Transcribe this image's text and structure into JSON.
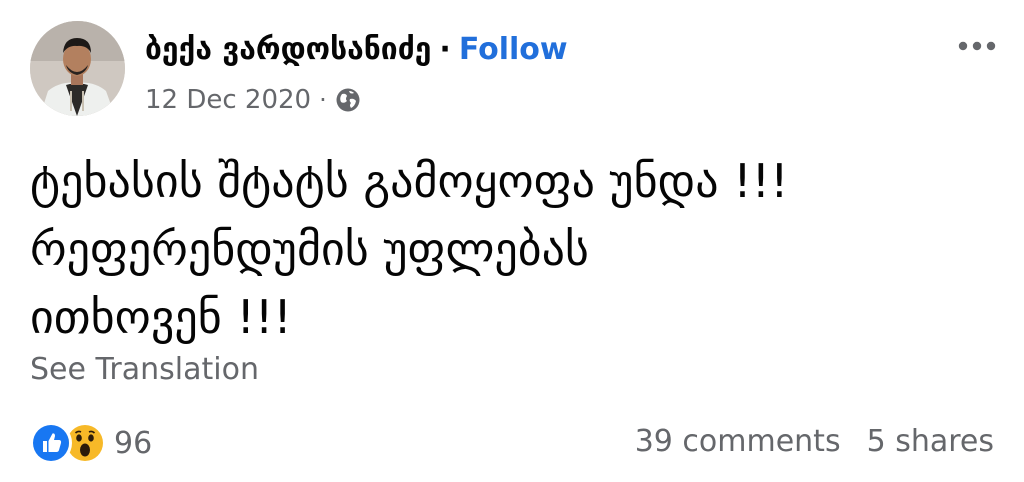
{
  "post": {
    "author": "ბექა ვარდოსანიძე",
    "separator": "·",
    "follow_label": "Follow",
    "date": "12 Dec 2020",
    "meta_separator": "·",
    "privacy_icon": "globe-icon",
    "more_icon": "more-horizontal-icon",
    "text_lines": [
      "ტეხასის შტატს გამოყოფა უნდა !!!",
      "რეფერენდუმის უფლებას",
      "ითხოვენ !!!"
    ],
    "see_translation_label": "See Translation",
    "reactions": {
      "icons": [
        "like-icon",
        "wow-icon"
      ],
      "count": "96"
    },
    "comments_label": "39 comments",
    "shares_label": "5 shares"
  },
  "colors": {
    "follow_blue": "#216fdb",
    "secondary_text": "#65676b",
    "like_blue": "#1877f2",
    "wow_yellow": "#f7b928"
  }
}
